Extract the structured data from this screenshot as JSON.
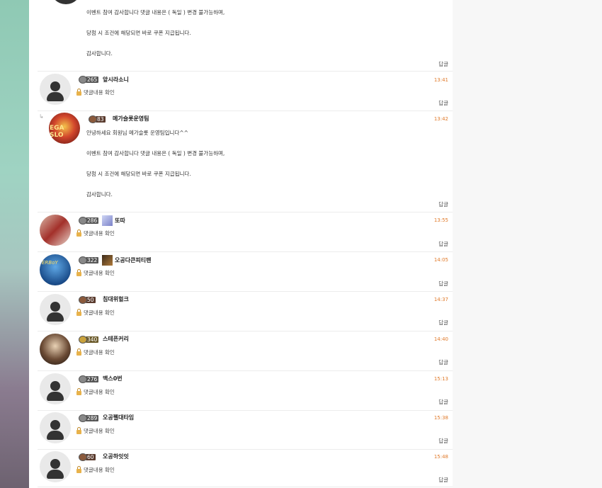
{
  "top_reply": {
    "lines": [
      "이벤트 참여 감사합니다 댓글 내용은 ( 독일 ) 변경 불가능하며,",
      "당첨 시 조건에 해당되면 바로 쿠폰 지급됩니다.",
      "감사합니다."
    ],
    "reply_label": "답글"
  },
  "comments": [
    {
      "level": "265",
      "nick": "앞시라소니",
      "time": "13:41",
      "secret": "댓글내용 확인",
      "reply": "답글"
    },
    {
      "level": "83",
      "nick": "메가슬롯운영팀",
      "time": "13:42",
      "greeting": "안녕하세요 회원님 메가슬롯 운영팀입니다^^",
      "lines": [
        "이벤트 참여 감사합니다 댓글 내용은 ( 독일 ) 변경 불가능하며,",
        "당첨 시 조건에 해당되면 바로 쿠폰 지급됩니다.",
        "감사합니다."
      ],
      "reply": "답글",
      "avatar_text": "EGA SLO"
    },
    {
      "level": "286",
      "nick": "또따",
      "time": "13:55",
      "secret": "댓글내용 확인",
      "reply": "답글"
    },
    {
      "level": "322",
      "nick": "오공다큰피티팬",
      "time": "14:05",
      "secret": "댓글내용 확인",
      "reply": "답글",
      "avatar_text": "ERBoY"
    },
    {
      "level": "50",
      "nick": "침대위헐크",
      "time": "14:37",
      "secret": "댓글내용 확인",
      "reply": "답글"
    },
    {
      "level": "340",
      "nick": "스테픈커리",
      "time": "14:40",
      "secret": "댓글내용 확인",
      "reply": "답글"
    },
    {
      "level": "276",
      "nick": "맥스0번",
      "time": "15:13",
      "secret": "댓글내용 확인",
      "reply": "답글"
    },
    {
      "level": "289",
      "nick": "오공펠대타임",
      "time": "15:38",
      "secret": "댓글내용 확인",
      "reply": "답글"
    },
    {
      "level": "60",
      "nick": "오공하잇잇",
      "time": "15:48",
      "secret": "댓글내용 확인",
      "reply": "답글"
    }
  ],
  "colors": {
    "time": "#e07a2a",
    "panel": "#ffffff",
    "side_top": "#8fc9b4",
    "side_bottom": "#6d6270"
  },
  "icons": {
    "default_avatar": "user-silhouette-icon",
    "secret": "lock-icon",
    "reply_arrow": "reply-arrow-icon"
  }
}
